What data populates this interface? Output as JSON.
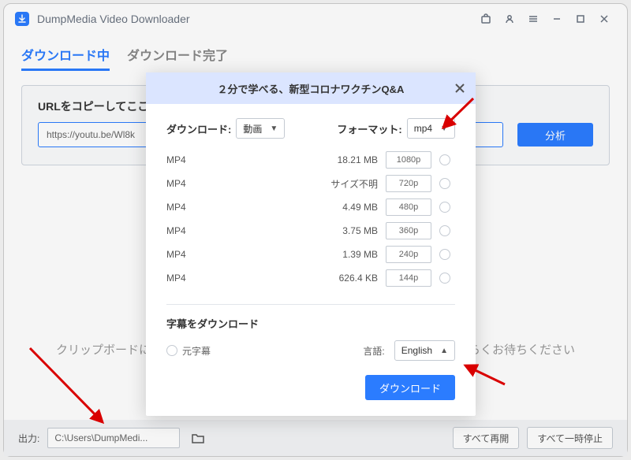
{
  "app": {
    "title": "DumpMedia Video Downloader"
  },
  "tabs": {
    "downloading": "ダウンロード中",
    "completed": "ダウンロード完了"
  },
  "urlPanel": {
    "label": "URLをコピーしてここに貼り付けます：",
    "value": "https://youtu.be/Wl8k",
    "analyze": "分析"
  },
  "empty": "クリップボードにリンクが含まれている場合、自動的に解析を始めます。しばらくお待ちください",
  "footer": {
    "outputLabel": "出力:",
    "path": "C:\\Users\\DumpMedi...",
    "resumeAll": "すべて再開",
    "pauseAll": "すべて一時停止"
  },
  "modal": {
    "title": "２分で学べる、新型コロナワクチンQ&A",
    "downloadLabel": "ダウンロード:",
    "downloadValue": "動画",
    "formatLabel": "フォーマット:",
    "formatValue": "mp4",
    "formats": [
      {
        "type": "MP4",
        "size": "18.21 MB",
        "res": "1080p"
      },
      {
        "type": "MP4",
        "size": "サイズ不明",
        "res": "720p"
      },
      {
        "type": "MP4",
        "size": "4.49 MB",
        "res": "480p"
      },
      {
        "type": "MP4",
        "size": "3.75 MB",
        "res": "360p"
      },
      {
        "type": "MP4",
        "size": "1.39 MB",
        "res": "240p"
      },
      {
        "type": "MP4",
        "size": "626.4 KB",
        "res": "144p"
      }
    ],
    "subtitleTitle": "字幕をダウンロード",
    "originalSub": "元字幕",
    "langLabel": "言語:",
    "langValue": "English",
    "downloadBtn": "ダウンロード"
  }
}
